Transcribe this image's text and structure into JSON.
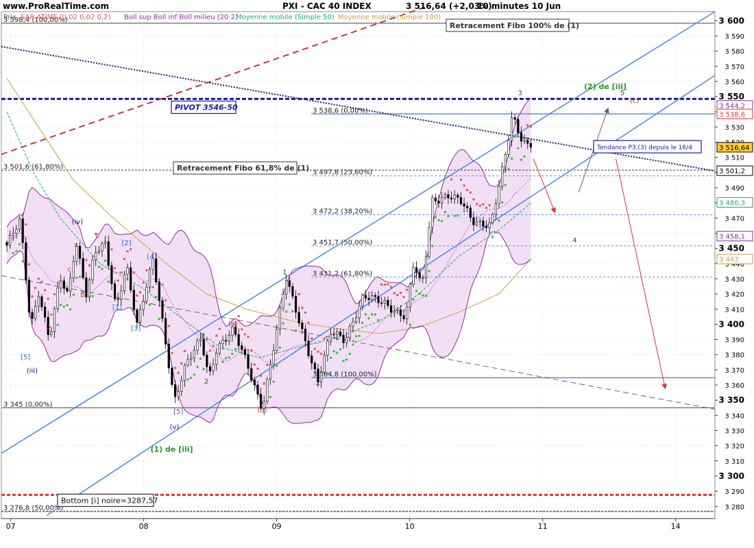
{
  "header": {
    "site": "www.ProRealTime.com",
    "instrument": "PXI - CAC 40 INDEX",
    "quote": "3 516,64  (+2,03%)",
    "timeframe": "10 minutes  10 Jun"
  },
  "legend": {
    "price": "Prix",
    "sar": "SAR ATIME (0,02 0,02 0,2)",
    "boll": "Boll sup Boll inf Boll milieu (20 2)",
    "ma50": "Moyenne mobile (Simple 50)",
    "ma100": "Moyenne mobile (Simple 100)"
  },
  "colors": {
    "candle": "#000000",
    "sar": "#dd5555",
    "sar_up": "#33bb33",
    "boll_band": "#8b2b9e",
    "boll_fill": "#f3dff5",
    "ma50": "#20a878",
    "ma100": "#c9a040",
    "channel": "#4a86e8",
    "pivot": "#1a1a9e",
    "red_line": "#dd3333",
    "grid": "#999999"
  },
  "chart_data": {
    "type": "candlestick",
    "ylim": [
      3272,
      3606
    ],
    "x_labels": [
      "07",
      "08",
      "09",
      "10",
      "11",
      "14"
    ],
    "y_ticks": [
      3280,
      3290,
      3300,
      3310,
      3320,
      3330,
      3340,
      3350,
      3360,
      3370,
      3380,
      3390,
      3400,
      3410,
      3420,
      3430,
      3440,
      3450,
      3460,
      3470,
      3480,
      3490,
      3500,
      3510,
      3520,
      3530,
      3540,
      3550,
      3560,
      3570,
      3580,
      3590,
      3600
    ],
    "y_tick_labels": [
      "3 280",
      "3 290",
      "3 300",
      "3 310",
      "3 320",
      "3 330",
      "3 340",
      "3 350",
      "3 360",
      "3 370",
      "3 380",
      "3 390",
      "3 400",
      "3 410",
      "3 420",
      "3 430",
      "3 440",
      "3 450",
      "3 460",
      "3 470",
      "3 480",
      "3 490",
      "3 500",
      "3 510",
      "3 520",
      "3 530",
      "3 540",
      "3 550",
      "3 560",
      "3 570",
      "3 580",
      "3 590",
      "3 600"
    ],
    "bold_ticks": [
      3300,
      3350,
      3400,
      3450,
      3500,
      3550,
      3600
    ],
    "last_close": 3516.64,
    "price_badges": [
      {
        "value": 3544.2,
        "label": "3 544,2",
        "color": "#8b2b9e",
        "fill": "#ffffff"
      },
      {
        "value": 3538.6,
        "label": "3 538,6",
        "color": "#dd3333",
        "fill": "#ffffff"
      },
      {
        "value": 3516.64,
        "label": "3 516,64",
        "color": "#000000",
        "fill": "#ffcc33"
      },
      {
        "value": 3501.2,
        "label": "3 501,2",
        "color": "#000000",
        "fill": "#ffffff"
      },
      {
        "value": 3480.3,
        "label": "3 480,3",
        "color": "#20a878",
        "fill": "#ffffff"
      },
      {
        "value": 3458.1,
        "label": "3 458,1",
        "color": "#8b2b9e",
        "fill": "#ffffff"
      },
      {
        "value": 3443,
        "label": "3 443",
        "color": "#c9a040",
        "fill": "#ffffff"
      }
    ],
    "h_levels": [
      {
        "value": 3598.4,
        "label": "3 598,4 (100,00%)"
      },
      {
        "value": 3501.6,
        "label": "3 501,6 (61,80%)"
      },
      {
        "value": 3345,
        "label": "3 345 (0,00%)"
      },
      {
        "value": 3276.8,
        "label": "3 276,8 (50,00%)"
      }
    ],
    "fibo_levels": [
      {
        "value": 3538.6,
        "label": "3 538,6 (0,00%)"
      },
      {
        "value": 3497.8,
        "label": "3 497,8 (23,60%)"
      },
      {
        "value": 3472.2,
        "label": "3 472,2 (38,20%)"
      },
      {
        "value": 3451.7,
        "label": "3 451,7 (50,00%)"
      },
      {
        "value": 3431.2,
        "label": "3 431,2 (61,80%)"
      },
      {
        "value": 3364.8,
        "label": "3 364,8 (100,00%)"
      }
    ],
    "boxes": [
      {
        "text": "Retracement Fibo 100% de (1)",
        "value": 3597
      },
      {
        "text": "Retracement Fibo 61,8% de (1)",
        "value": 3503
      },
      {
        "text": "PIVOT 3546-50",
        "value": 3543
      },
      {
        "text": "Tendance P3.(3) depuis le 16/4",
        "value": 3517
      },
      {
        "text": "Bottom [i] noire=3287,57",
        "value": 3284
      }
    ],
    "wave_labels": [
      {
        "text": "(iv)",
        "x": 2.65,
        "y": 3466
      },
      {
        "text": "(iii)",
        "x": 0.95,
        "y": 3368
      },
      {
        "text": "(v)",
        "x": 6.3,
        "y": 3331
      },
      {
        "text": "(1) de [iii]",
        "x": 6.2,
        "y": 3316
      },
      {
        "text": "(a)",
        "x": 8.5,
        "y": 3399
      },
      {
        "text": "(b)",
        "x": 9.6,
        "y": 3342
      },
      {
        "text": "(c)",
        "x": 23.6,
        "y": 3546
      },
      {
        "text": "(2) de [iii]",
        "x": 22.5,
        "y": 3555
      },
      {
        "text": "a",
        "x": 1.95,
        "y": 3426
      },
      {
        "text": "b",
        "x": 1.55,
        "y": 3397
      },
      {
        "text": "c",
        "x": 2.35,
        "y": 3435
      },
      {
        "text": "a",
        "x": 2.6,
        "y": 3451
      },
      {
        "text": "b",
        "x": 2.85,
        "y": 3418
      },
      {
        "text": "c",
        "x": 3.4,
        "y": 3457
      },
      {
        "text": "[5]",
        "x": 0.7,
        "y": 3377
      },
      {
        "text": "[1]",
        "x": 4.15,
        "y": 3410
      },
      {
        "text": "[2]",
        "x": 4.5,
        "y": 3452
      },
      {
        "text": "[3]",
        "x": 4.85,
        "y": 3396
      },
      {
        "text": "[4]",
        "x": 5.45,
        "y": 3443
      },
      {
        "text": "[5]",
        "x": 6.45,
        "y": 3341
      },
      {
        "text": "1",
        "x": 7.35,
        "y": 3391
      },
      {
        "text": "2",
        "x": 7.5,
        "y": 3361
      },
      {
        "text": "1",
        "x": 10.45,
        "y": 3433
      },
      {
        "text": "2",
        "x": 11.7,
        "y": 3360
      },
      {
        "text": "3",
        "x": 19.3,
        "y": 3551
      },
      {
        "text": "4",
        "x": 21.35,
        "y": 3454
      },
      {
        "text": "5",
        "x": 23.15,
        "y": 3551
      }
    ],
    "x_day_positions": [
      0.3,
      5.3,
      10.3,
      15.3,
      20.3,
      25.3
    ]
  }
}
